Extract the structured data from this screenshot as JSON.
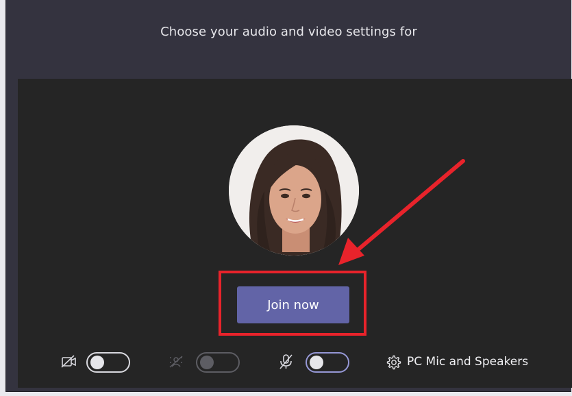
{
  "dialog": {
    "heading": "Choose your audio and video settings for"
  },
  "preview": {
    "avatar_alt": "user-avatar"
  },
  "join": {
    "label": "Join now"
  },
  "controls": {
    "video_icon": "camera-off-icon",
    "video_enabled": false,
    "blur_icon": "background-blur-icon",
    "blur_enabled": false,
    "mic_icon": "mic-off-icon",
    "mic_enabled": false,
    "settings_icon": "gear-icon",
    "device_label": "PC Mic and Speakers"
  },
  "colors": {
    "window_bg": "#34333f",
    "preview_bg": "#252525",
    "join_button": "#6264a7",
    "highlight": "#e8232b",
    "toggle_focus": "#9698d6"
  }
}
